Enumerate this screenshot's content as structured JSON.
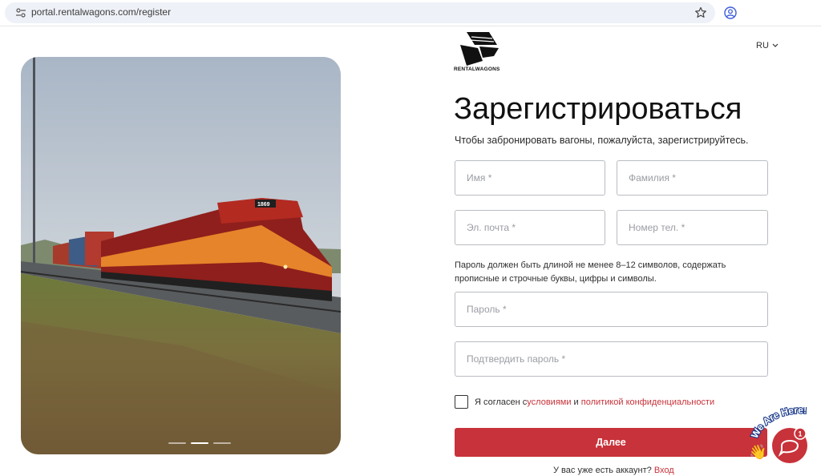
{
  "browser": {
    "url": "portal.rentalwagons.com/register"
  },
  "brand": {
    "name": "RENTALWAGONS",
    "accent_color": "#c8323a"
  },
  "language": {
    "selected": "RU"
  },
  "form": {
    "title": "Зарегистрироваться",
    "subtitle": "Чтобы забронировать вагоны, пожалуйста, зарегистрируйтесь.",
    "first_name_placeholder": "Имя *",
    "last_name_placeholder": "Фамилия *",
    "email_placeholder": "Эл. почта *",
    "phone_placeholder": "Номер тел. *",
    "password_hint": "Пароль должен быть длиной не менее 8–12 символов, содержать прописные и строчные буквы, цифры и символы.",
    "password_placeholder": "Пароль *",
    "confirm_password_placeholder": "Подтвердить пароль *",
    "agree_prefix": "Я согласен с ",
    "terms_link": "условиями",
    "agree_and": " и ",
    "privacy_link": "политикой конфиденциальности",
    "submit_label": "Далее",
    "have_account_text": "У вас уже есть аккаунт? ",
    "login_link": "Вход"
  },
  "carousel": {
    "slides": 3,
    "active_index": 1
  },
  "photo": {
    "locomotive_number": "1869"
  },
  "chat_widget": {
    "banner": "We Are Here!",
    "badge_count": "1"
  }
}
